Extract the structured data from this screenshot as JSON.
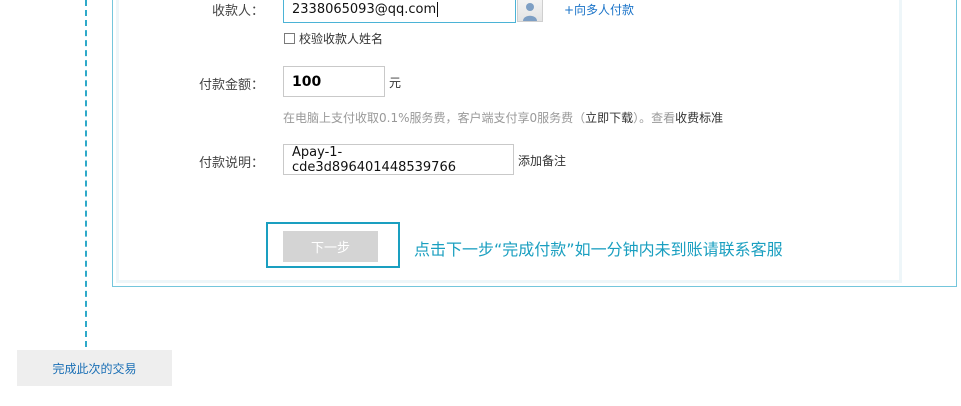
{
  "form": {
    "payee_label": "收款人：",
    "payee_value": "2338065093@qq.com",
    "contact_icon": "person-icon",
    "multi_pay_link": "+向多人付款",
    "verify_name_label": "校验收款人姓名",
    "verify_name_checked": false,
    "amount_label": "付款金额：",
    "amount_value": "100",
    "amount_unit": "元",
    "fee_note": {
      "text_before": "在电脑上支付收取0.1%服务费，客户端支付享0服务费（",
      "download_link": "立即下载",
      "text_middle": "）。查看",
      "fee_standard_link": "收费标准"
    },
    "memo_label": "付款说明：",
    "memo_value": "Apay-1-cde3d896401448539766",
    "add_memo_link": "添加备注",
    "next_button": "下一步",
    "hint_text": "点击下一步“完成付款”如一分钟内未到账请联系客服"
  },
  "sidebar": {
    "complete_button": "完成此次的交易"
  },
  "colors": {
    "accent": "#1a9fc0",
    "link": "#1a73c8",
    "disabled_button": "#d4d4d4",
    "muted_text": "#999999"
  }
}
